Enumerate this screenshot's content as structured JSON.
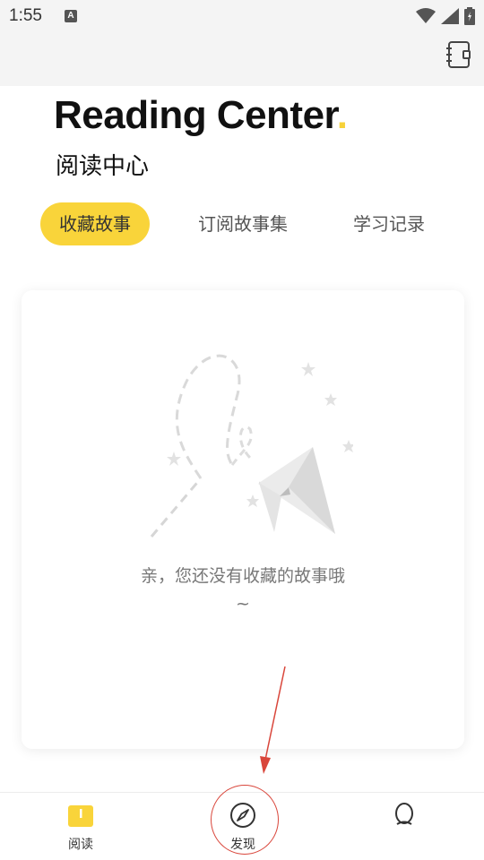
{
  "status_bar": {
    "time": "1:55",
    "notification_letter": "A"
  },
  "header": {
    "title": "Reading Center",
    "title_dot": ".",
    "subtitle": "阅读中心",
    "accent_color": "#f9d43a"
  },
  "tabs": [
    {
      "label": "收藏故事",
      "active": true
    },
    {
      "label": "订阅故事集",
      "active": false
    },
    {
      "label": "学习记录",
      "active": false
    }
  ],
  "empty_state": {
    "message": "亲，您还没有收藏的故事哦~"
  },
  "bottom_nav": [
    {
      "label": "阅读",
      "icon": "book-icon",
      "active": true
    },
    {
      "label": "发现",
      "icon": "compass-icon",
      "active": false
    },
    {
      "label": "",
      "icon": "profile-icon",
      "active": false
    }
  ]
}
